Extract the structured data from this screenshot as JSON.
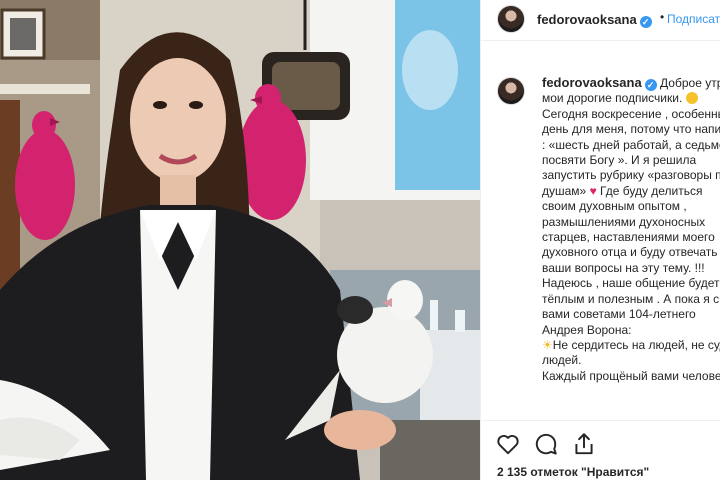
{
  "post": {
    "username": "fedorovaoksana",
    "follow_label": "Подписаться",
    "separator": "•",
    "verified_mark": "✓",
    "caption_lines": [
      "Доброе утро",
      "мои дорогие подписчики. ",
      "Сегодня воскресение , особенный",
      "день для меня, потому что написано",
      ": «шесть дней работай, а седьмой",
      "посвяти Богу ». И я решила",
      "запустить рубрику «разговоры по",
      "душам» ",
      " Где буду делиться",
      "своим духовным опытом ,",
      "размышлениями духоносных",
      "старцев, наставлениями моего",
      "духовного отца и буду отвечать на",
      "ваши вопросы на эту тему. !!!",
      "Надеюсь , наше общение будет",
      "тёплым и полезным . А пока я с",
      "вами советами 104-летнего",
      "Андрея Ворона:",
      "Не сердитесь на людей, не судите",
      "людей.",
      "Каждый прощёный вами человек"
    ],
    "likes_text": "2 135 отметок \"Нравится\""
  },
  "icons": {
    "like": "heart-outline-icon",
    "comment": "comment-bubble-icon",
    "share": "share-upload-icon",
    "verified": "verified-badge-icon"
  },
  "colors": {
    "accent": "#3897f0",
    "heart": "#e0245e",
    "text": "#262626",
    "border": "#efefef"
  }
}
